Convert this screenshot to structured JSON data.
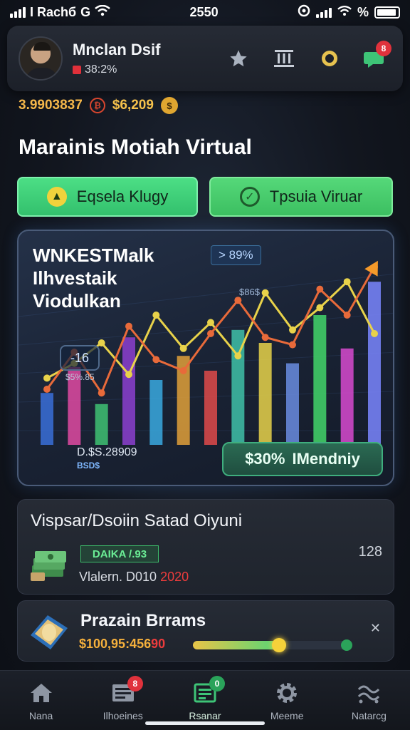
{
  "status_bar": {
    "carrier": "I Rachб",
    "time": "2550",
    "battery": "%"
  },
  "header": {
    "user_name": "Mnclan Dsif",
    "user_stat": "38:2%"
  },
  "balance": {
    "main": "3.9903837",
    "secondary": "$6,209"
  },
  "page_title": "Marainis Motiah Virtual",
  "actions": {
    "left_label": "Eqsela Klugy",
    "right_label": "Tpsuia Viruar"
  },
  "hero": {
    "title_lines": [
      "WNKESTMalk",
      "Ilhvestaik",
      "Viodulkan"
    ],
    "top_tag": "> 89%",
    "small_top": "$86$",
    "hex_value": "-16",
    "small_mid": "$5%.85",
    "bottom_value": "D.$S.28909",
    "bottom_code": "BSD$",
    "pill_percent": "$30%",
    "pill_label": "IMendniy",
    "bars": [
      28,
      42,
      22,
      58,
      35,
      48,
      40,
      62,
      55,
      44,
      70,
      52,
      88
    ],
    "line_a": [
      30,
      50,
      28,
      64,
      46,
      40,
      60,
      78,
      58,
      54,
      84,
      70,
      96
    ],
    "line_b": [
      36,
      44,
      55,
      38,
      70,
      52,
      66,
      48,
      82,
      62,
      74,
      88,
      60
    ]
  },
  "card_investment": {
    "title": "Vispsar/Dsoiin Satad Oiyuni",
    "badge": "DAIKA /.93",
    "value_prefix": "Vlalern. D010",
    "value_red": "2020",
    "count": "128"
  },
  "card_bonus": {
    "title": "Prazain Brrams",
    "amount_prefix": "$100,95:456",
    "amount_red": "90",
    "progress": 0.55
  },
  "nav": {
    "items": [
      {
        "label": "Nana",
        "icon": "home-icon"
      },
      {
        "label": "Ilhoeines",
        "icon": "news-icon",
        "badge": "8"
      },
      {
        "label": "Rsanar",
        "icon": "ledger-icon",
        "badge": "0"
      },
      {
        "label": "Meeme",
        "icon": "gear-icon"
      },
      {
        "label": "Natarcg",
        "icon": "network-icon"
      }
    ],
    "active_index": 2
  },
  "colors": {
    "accent_green": "#3ec477",
    "accent_gold": "#f5b74a",
    "alert_red": "#e0323c"
  }
}
